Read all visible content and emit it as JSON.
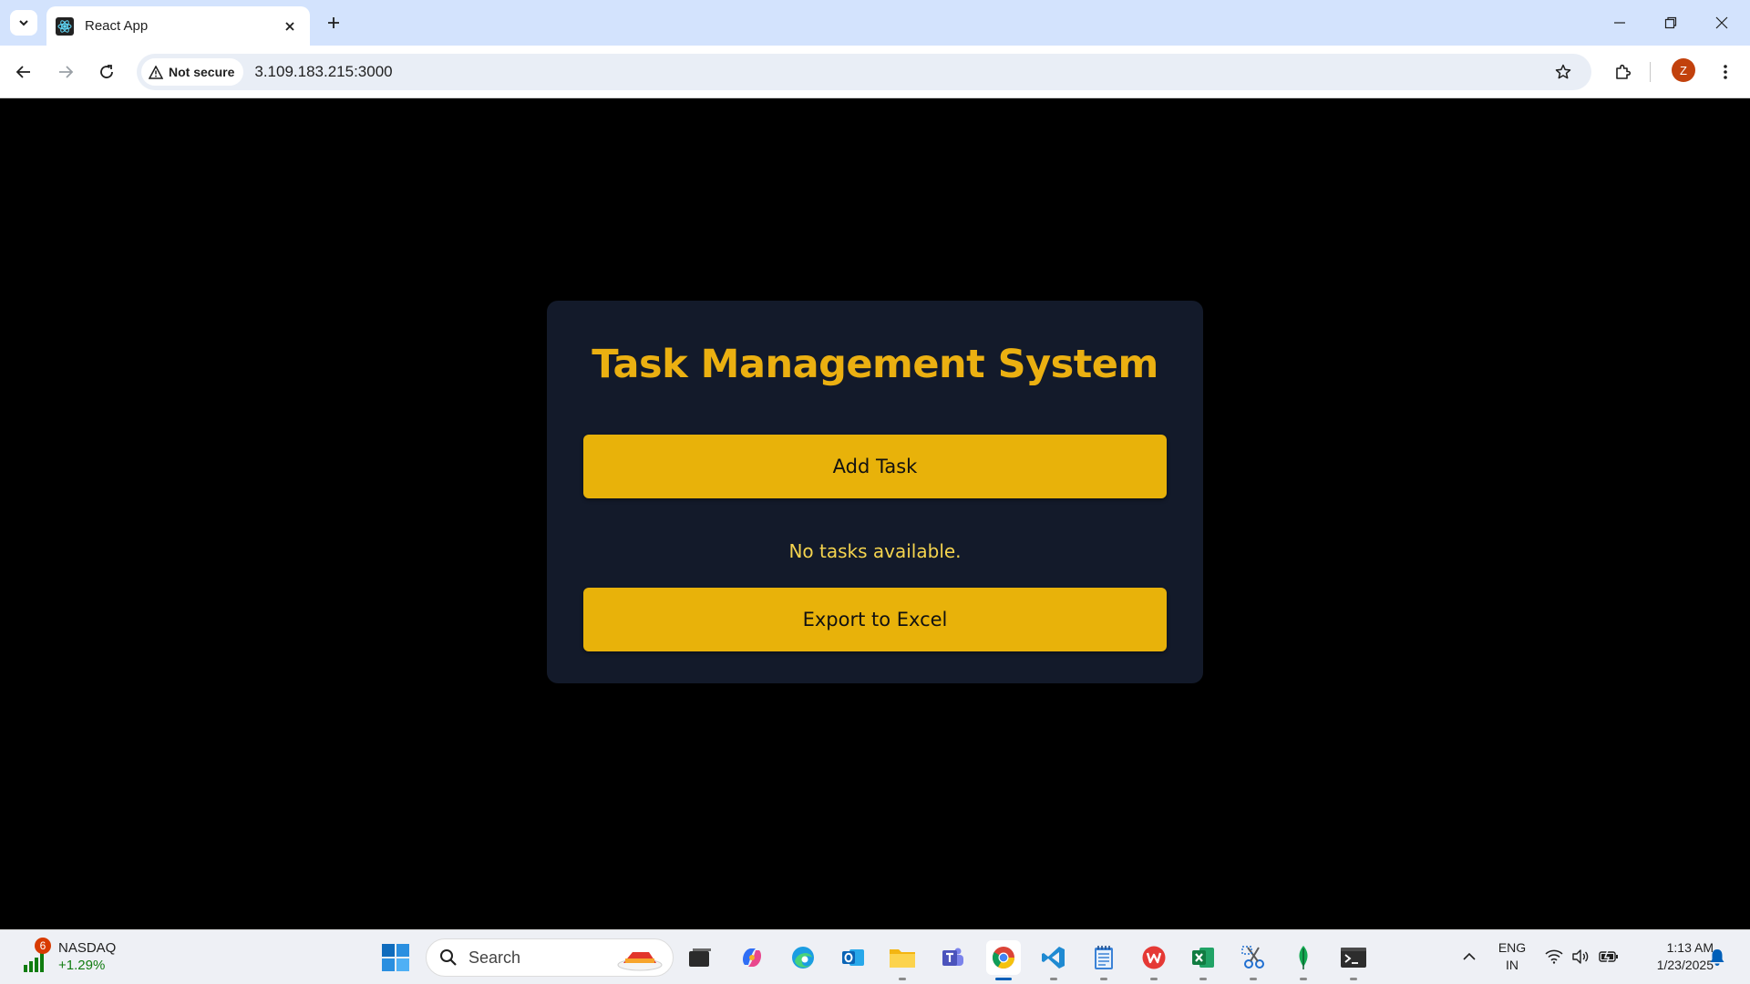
{
  "colors": {
    "tabstrip_bg": "#d3e3fd",
    "page_bg": "#000000",
    "card_bg": "#131a2a",
    "accent": "#e8b20a",
    "title": "#ebb011",
    "empty_text": "#f5d44e",
    "avatar": "#c2410c",
    "widget_badge": "#d83b01",
    "widget_up": "#107c10"
  },
  "browser": {
    "tab": {
      "title": "React App",
      "favicon": "react-icon"
    },
    "address": {
      "security_label": "Not secure",
      "url": "3.109.183.215:3000"
    },
    "profile_initial": "Z"
  },
  "app": {
    "title": "Task Management System",
    "add_task_label": "Add Task",
    "empty_message": "No tasks available.",
    "export_label": "Export to Excel"
  },
  "taskbar": {
    "widget": {
      "badge": "6",
      "name": "NASDAQ",
      "change": "+1.29%"
    },
    "search_placeholder": "Search",
    "apps": [
      "task-view-icon",
      "copilot-icon",
      "edge-icon",
      "outlook-icon",
      "file-explorer-icon",
      "teams-icon",
      "chrome-icon",
      "vscode-icon",
      "notepad-icon",
      "wps-office-icon",
      "excel-icon",
      "snipping-tool-icon",
      "mongodb-compass-icon",
      "terminal-icon"
    ],
    "language": {
      "line1": "ENG",
      "line2": "IN"
    },
    "clock": {
      "time": "1:13 AM",
      "date": "1/23/2025"
    }
  }
}
